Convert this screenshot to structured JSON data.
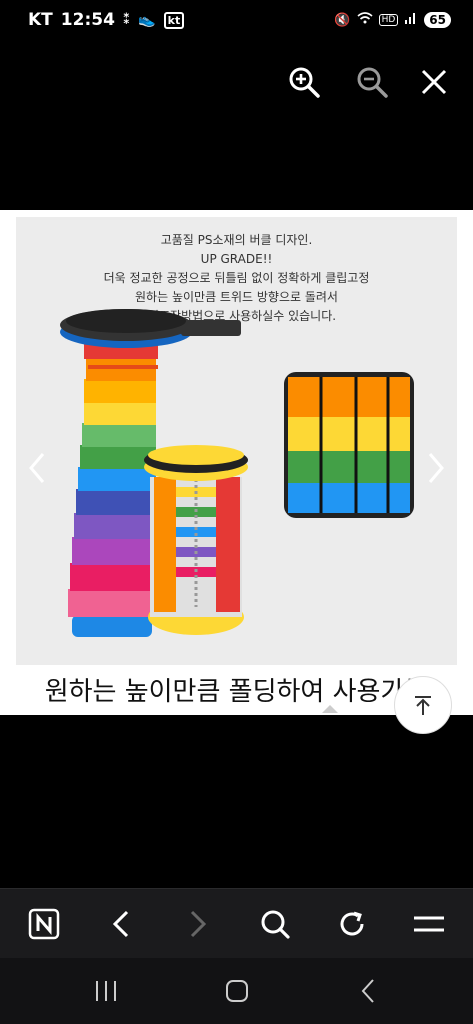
{
  "status_bar": {
    "carrier": "KT",
    "time": "12:54",
    "kt_label": "kt",
    "hd_label": "HD",
    "battery": "65"
  },
  "product_image": {
    "description_lines": [
      "고품질 PS소재의 버클 디자인.",
      "UP GRADE!!",
      "더욱 정교한 공정으로 뒤틀림 없이 정확하게 클립고정",
      "원하는 높이만큼 트위드 방향으로 돌려서",
      "간편조작방법으로 사용하실수 있습니다."
    ],
    "caption": "원하는 높이만큼 폴딩하여 사용가능"
  },
  "colors": {
    "toolbar_bg": "#1b1b1d",
    "nav_bg": "#121214",
    "arrow_color": "#ffffff"
  },
  "icons": {
    "zoom_in": "zoom-in-icon",
    "zoom_out": "zoom-out-icon",
    "close": "close-icon",
    "naver": "naver-icon",
    "back": "back-icon",
    "forward": "forward-icon",
    "search": "search-icon",
    "reload": "reload-icon",
    "menu": "menu-icon"
  }
}
